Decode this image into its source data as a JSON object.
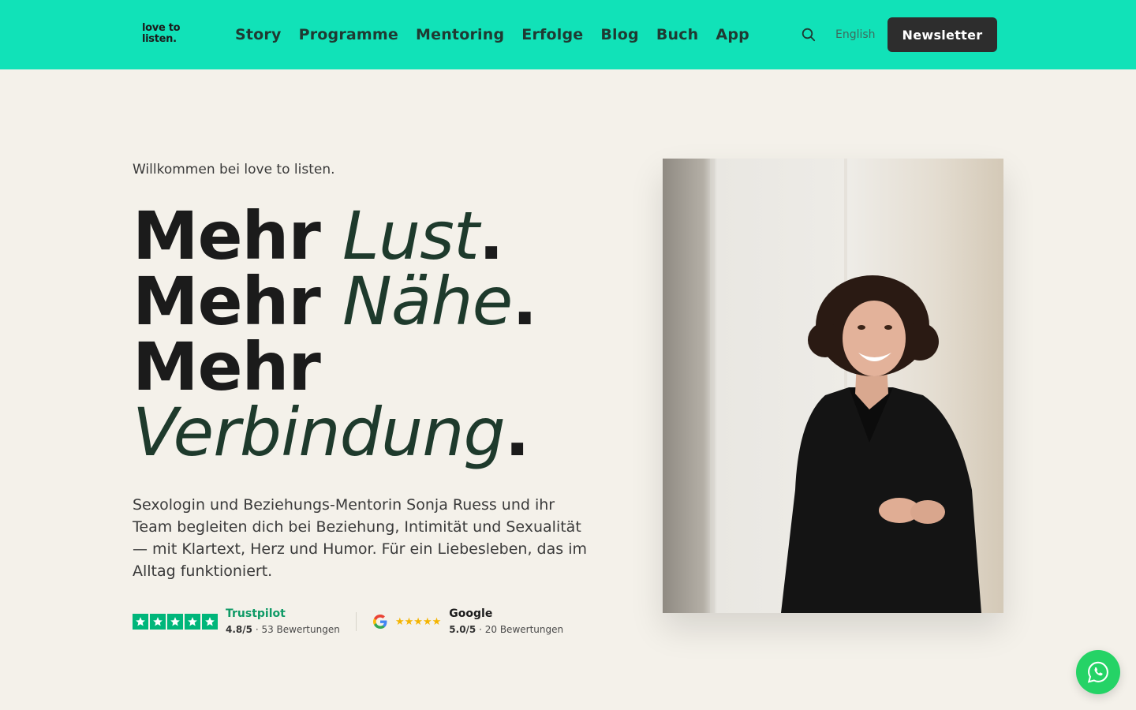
{
  "header": {
    "logo_line1": "love to",
    "logo_line2": "listen.",
    "nav": [
      "Story",
      "Programme",
      "Mentoring",
      "Erfolge",
      "Blog",
      "Buch",
      "App"
    ],
    "search_icon": "search-icon",
    "language_link": "English",
    "newsletter_label": "Newsletter",
    "bg_color": "#11e2b8"
  },
  "hero": {
    "eyebrow": "Willkommen bei love to listen.",
    "headline": [
      {
        "bold": "Mehr ",
        "italic": "Lust",
        "end": "."
      },
      {
        "bold": "Mehr ",
        "italic": "Nähe",
        "end": "."
      },
      {
        "bold": "Mehr",
        "italic": "",
        "end": ""
      },
      {
        "bold": "",
        "italic": "Verbindung",
        "end": "."
      }
    ],
    "lead": "Sexologin und Beziehungs-Mentorin Sonja Ruess und ihr Team begleiten dich bei Beziehung, Intimität und Sexualität — mit Klartext, Herz und Humor. Für ein Liebesleben, das im Alltag funktioniert."
  },
  "ratings": {
    "trustpilot": {
      "name": "Trustpilot",
      "score": "4.8/5",
      "reviews": "· 53 Bewertungen",
      "stars": 5,
      "color": "#00b67a"
    },
    "google": {
      "name": "Google",
      "score": "5.0/5",
      "reviews": "· 20 Bewertungen",
      "stars_text": "★★★★★",
      "star_color": "#f4b400"
    }
  },
  "photo": {
    "icon": "portrait-photo"
  },
  "whatsapp": {
    "icon": "whatsapp-icon",
    "color": "#25d366"
  }
}
